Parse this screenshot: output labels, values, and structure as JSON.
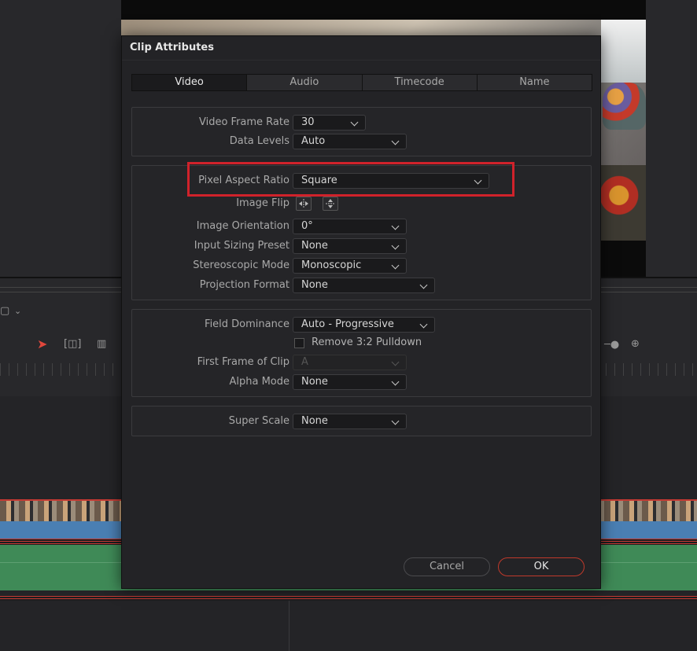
{
  "dialog": {
    "title": "Clip Attributes",
    "tabs": [
      {
        "label": "Video",
        "active": true
      },
      {
        "label": "Audio",
        "active": false
      },
      {
        "label": "Timecode",
        "active": false
      },
      {
        "label": "Name",
        "active": false
      }
    ],
    "group1": {
      "video_frame_rate": {
        "label": "Video Frame Rate",
        "value": "30"
      },
      "data_levels": {
        "label": "Data Levels",
        "value": "Auto"
      }
    },
    "group2": {
      "pixel_aspect_ratio": {
        "label": "Pixel Aspect Ratio",
        "value": "Square"
      },
      "image_flip": {
        "label": "Image Flip"
      },
      "image_orientation": {
        "label": "Image Orientation",
        "value": "0°"
      },
      "input_sizing_preset": {
        "label": "Input Sizing Preset",
        "value": "None"
      },
      "stereoscopic_mode": {
        "label": "Stereoscopic Mode",
        "value": "Monoscopic"
      },
      "projection_format": {
        "label": "Projection Format",
        "value": "None"
      }
    },
    "group3": {
      "field_dominance": {
        "label": "Field Dominance",
        "value": "Auto - Progressive"
      },
      "remove_pulldown": {
        "label": "Remove 3:2 Pulldown",
        "checked": false
      },
      "first_frame": {
        "label": "First Frame of Clip",
        "value": "A"
      },
      "alpha_mode": {
        "label": "Alpha Mode",
        "value": "None"
      }
    },
    "group4": {
      "super_scale": {
        "label": "Super Scale",
        "value": "None"
      }
    },
    "buttons": {
      "cancel": "Cancel",
      "ok": "OK"
    }
  },
  "colors": {
    "accent_red": "#d0222b",
    "ok_border": "#c0392b",
    "dialog_bg": "#232326"
  },
  "icons": [
    "flip-horizontal-icon",
    "flip-vertical-icon",
    "pointer-tool-icon",
    "trim-tool-icon",
    "blade-tool-icon",
    "zoom-in-icon"
  ]
}
